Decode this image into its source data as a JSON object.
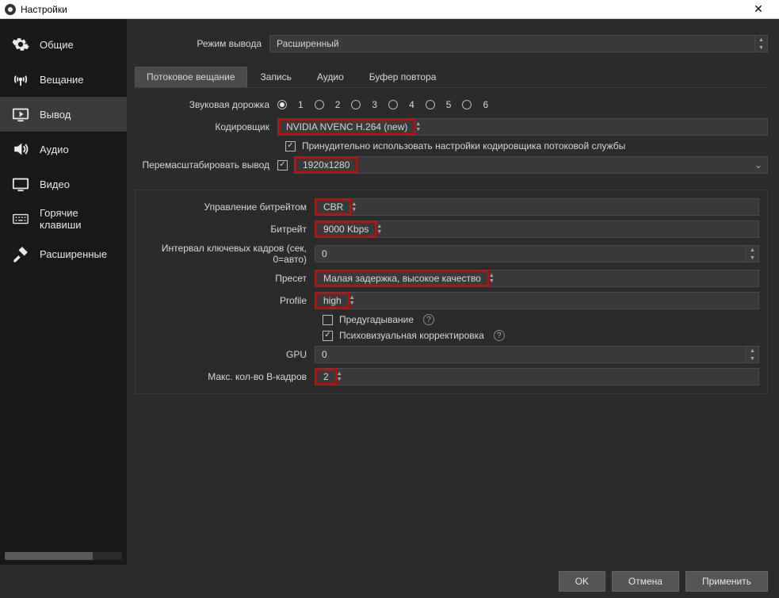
{
  "titlebar": {
    "title": "Настройки"
  },
  "sidebar": {
    "items": [
      {
        "label": "Общие"
      },
      {
        "label": "Вещание"
      },
      {
        "label": "Вывод"
      },
      {
        "label": "Аудио"
      },
      {
        "label": "Видео"
      },
      {
        "label": "Горячие клавиши"
      },
      {
        "label": "Расширенные"
      }
    ]
  },
  "output_mode": {
    "label": "Режим вывода",
    "value": "Расширенный"
  },
  "tabs": [
    {
      "label": "Потоковое вещание"
    },
    {
      "label": "Запись"
    },
    {
      "label": "Аудио"
    },
    {
      "label": "Буфер повтора"
    }
  ],
  "audio_track": {
    "label": "Звуковая дорожка",
    "options": [
      "1",
      "2",
      "3",
      "4",
      "5",
      "6"
    ]
  },
  "encoder": {
    "label": "Кодировщик",
    "value": "NVIDIA NVENC H.264 (new)"
  },
  "enforce": {
    "label": "Принудительно использовать настройки кодировщика потоковой службы",
    "checked": true
  },
  "rescale": {
    "label": "Перемасштабировать вывод",
    "checked": true,
    "value": "1920x1280"
  },
  "bitrate_control": {
    "label": "Управление битрейтом",
    "value": "CBR"
  },
  "bitrate": {
    "label": "Битрейт",
    "value": "9000 Kbps"
  },
  "keyframe": {
    "label": "Интервал ключевых кадров (сек, 0=авто)",
    "value": "0"
  },
  "preset": {
    "label": "Пресет",
    "value": "Малая задержка, высокое качество"
  },
  "profile": {
    "label": "Profile",
    "value": "high"
  },
  "lookahead": {
    "label": "Предугадывание",
    "checked": false
  },
  "psycho": {
    "label": "Психовизуальная корректировка",
    "checked": true
  },
  "gpu": {
    "label": "GPU",
    "value": "0"
  },
  "bframes": {
    "label": "Макс. кол-во B-кадров",
    "value": "2"
  },
  "buttons": {
    "ok": "OK",
    "cancel": "Отмена",
    "apply": "Применить"
  }
}
